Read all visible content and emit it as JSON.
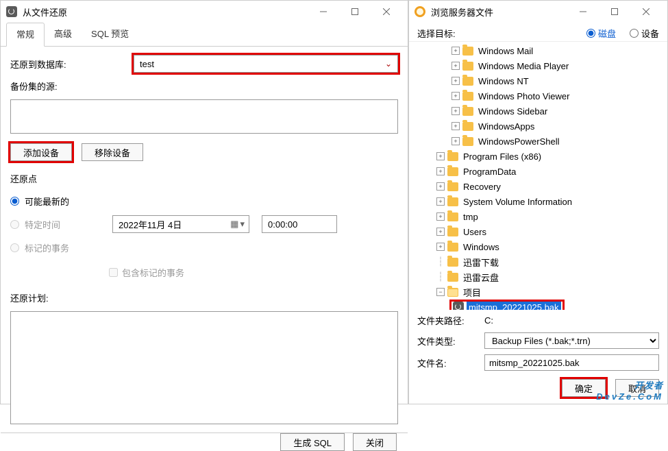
{
  "left": {
    "title": "从文件还原",
    "tabs": {
      "general": "常规",
      "advanced": "高级",
      "sqlpreview": "SQL 预览"
    },
    "restore_to_label": "还原到数据库:",
    "restore_to_value": "test",
    "backup_src_label": "备份集的源:",
    "add_device": "添加设备",
    "remove_device": "移除设备",
    "restore_point_label": "还原点",
    "radio_latest": "可能最新的",
    "radio_time": "特定时间",
    "radio_marked": "标记的事务",
    "date_value": "2022年11月  4日",
    "time_value": "0:00:00",
    "chk_include_marked": "包含标记的事务",
    "plan_label": "还原计划:",
    "footer_gensql": "生成 SQL",
    "footer_close": "关闭"
  },
  "right": {
    "title": "浏览服务器文件",
    "target_label": "选择目标:",
    "radio_disk": "磁盘",
    "radio_device": "设备",
    "tree_ind_a": [
      "Windows Mail",
      "Windows Media Player",
      "Windows NT",
      "Windows Photo Viewer",
      "Windows Sidebar",
      "WindowsApps",
      "WindowsPowerShell"
    ],
    "tree_ind_b": [
      "Program Files (x86)",
      "ProgramData",
      "Recovery",
      "System Volume Information",
      "tmp",
      "Users",
      "Windows"
    ],
    "tree_ind_b_noexp": [
      "迅雷下载",
      "迅雷云盘"
    ],
    "tree_project": "项目",
    "tree_selected": "mitsmp_20221025.bak",
    "path_label": "文件夹路径:",
    "path_value": "C:",
    "type_label": "文件类型:",
    "type_value": "Backup Files (*.bak;*.trn)",
    "name_label": "文件名:",
    "name_value": "mitsmp_20221025.bak",
    "ok": "确定",
    "cancel": "取消"
  },
  "watermark": {
    "line1": "开发者",
    "line2": "DevZe.CoM"
  }
}
